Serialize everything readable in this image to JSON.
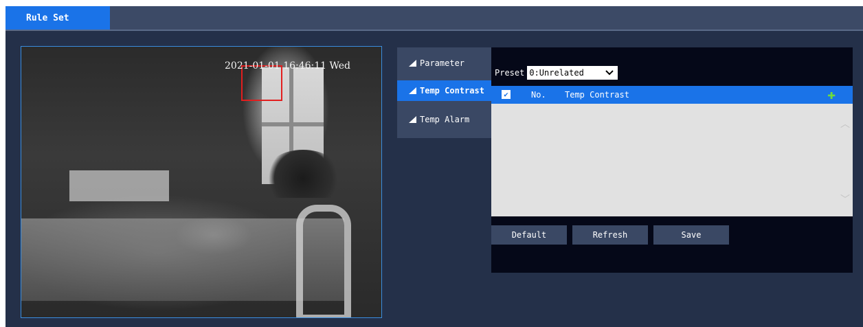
{
  "tabs": {
    "active_label": "Rule Set"
  },
  "video": {
    "osd_text": "2021-01-01 16:46:11 Wed"
  },
  "nav": {
    "items": [
      {
        "label": "Parameter",
        "active": false
      },
      {
        "label": "Temp Contrast",
        "active": true
      },
      {
        "label": "Temp Alarm",
        "active": false
      }
    ]
  },
  "preset": {
    "label": "Preset",
    "value": "0:Unrelated"
  },
  "table": {
    "col_no": "No.",
    "col_name": "Temp Contrast",
    "header_checkbox_checked": true,
    "add_icon": "plus-icon",
    "rows": []
  },
  "buttons": {
    "default": "Default",
    "refresh": "Refresh",
    "save": "Save"
  },
  "colors": {
    "accent": "#1a73e8",
    "bg": "#243049",
    "panel": "#050818",
    "add_icon": "#6fdc3a",
    "roi": "#e21e1e"
  }
}
